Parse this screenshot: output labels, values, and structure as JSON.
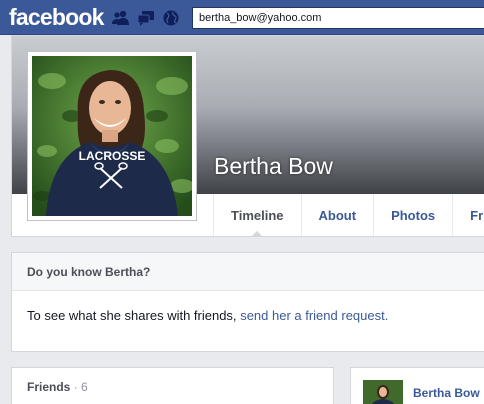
{
  "topbar": {
    "logo": "facebook",
    "search_value": "bertha_bow@yahoo.com"
  },
  "profile": {
    "name": "Bertha Bow",
    "shirt_text": "LACROSSE"
  },
  "nav": {
    "tabs": [
      "Timeline",
      "About",
      "Photos",
      "Fr"
    ]
  },
  "know_box": {
    "heading": "Do you know Bertha?",
    "text": "To see what she shares with friends,",
    "link": "send her a friend request."
  },
  "friends": {
    "title": "Friends",
    "count": "· 6"
  },
  "post": {
    "author": "Bertha Bow"
  },
  "colors": {
    "brand_blue": "#3b5998",
    "page_bg": "#e9eaed"
  }
}
